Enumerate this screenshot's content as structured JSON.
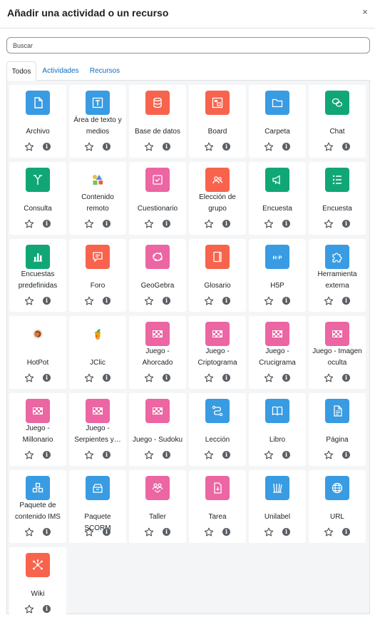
{
  "header": {
    "title": "Añadir una actividad o un recurso",
    "close_label": "×"
  },
  "search": {
    "placeholder": "Buscar"
  },
  "tabs": [
    {
      "label": "Todos",
      "active": true
    },
    {
      "label": "Actividades",
      "active": false
    },
    {
      "label": "Recursos",
      "active": false
    }
  ],
  "colors": {
    "blue": "#399be2",
    "orange": "#f7634d",
    "green": "#11a676",
    "pink": "#eb66a2",
    "tab_link": "#0f6cbf",
    "panel_bg": "#f4f5f7"
  },
  "items": [
    {
      "name": "Archivo",
      "icon": "file-icon",
      "color": "blue"
    },
    {
      "name": "Área de texto y medios",
      "icon": "text-media-icon",
      "color": "blue"
    },
    {
      "name": "Base de datos",
      "icon": "database-icon",
      "color": "orange"
    },
    {
      "name": "Board",
      "icon": "board-icon",
      "color": "orange"
    },
    {
      "name": "Carpeta",
      "icon": "folder-icon",
      "color": "blue"
    },
    {
      "name": "Chat",
      "icon": "chat-icon",
      "color": "green"
    },
    {
      "name": "Consulta",
      "icon": "choice-icon",
      "color": "green"
    },
    {
      "name": "Contenido remoto",
      "icon": "remote-content-icon",
      "color": "none"
    },
    {
      "name": "Cuestionario",
      "icon": "quiz-icon",
      "color": "pink"
    },
    {
      "name": "Elección de grupo",
      "icon": "group-choice-icon",
      "color": "orange"
    },
    {
      "name": "Encuesta",
      "icon": "feedback-icon",
      "color": "green"
    },
    {
      "name": "Encuesta",
      "icon": "survey-icon",
      "color": "green"
    },
    {
      "name": "Encuestas predefinidas",
      "icon": "bar-chart-icon",
      "color": "green"
    },
    {
      "name": "Foro",
      "icon": "forum-icon",
      "color": "orange"
    },
    {
      "name": "GeoGebra",
      "icon": "geogebra-icon",
      "color": "pink"
    },
    {
      "name": "Glosario",
      "icon": "glossary-icon",
      "color": "orange"
    },
    {
      "name": "H5P",
      "icon": "h5p-icon",
      "color": "blue"
    },
    {
      "name": "Herramienta externa",
      "icon": "puzzle-icon",
      "color": "blue"
    },
    {
      "name": "HotPot",
      "icon": "hotpot-icon",
      "color": "none"
    },
    {
      "name": "JClic",
      "icon": "jclic-icon",
      "color": "none"
    },
    {
      "name": "Juego - Ahorcado",
      "icon": "game-icon",
      "color": "pink"
    },
    {
      "name": "Juego - Criptograma",
      "icon": "game-icon",
      "color": "pink"
    },
    {
      "name": "Juego - Crucigrama",
      "icon": "game-icon",
      "color": "pink"
    },
    {
      "name": "Juego - Imagen oculta",
      "icon": "game-icon",
      "color": "pink"
    },
    {
      "name": "Juego - Millonario",
      "icon": "game-icon",
      "color": "pink"
    },
    {
      "name": "Juego - Serpientes y…",
      "icon": "game-icon",
      "color": "pink"
    },
    {
      "name": "Juego - Sudoku",
      "icon": "game-icon",
      "color": "pink"
    },
    {
      "name": "Lección",
      "icon": "lesson-icon",
      "color": "blue"
    },
    {
      "name": "Libro",
      "icon": "book-icon",
      "color": "blue"
    },
    {
      "name": "Página",
      "icon": "page-icon",
      "color": "blue"
    },
    {
      "name": "Paquete de contenido IMS",
      "icon": "ims-package-icon",
      "color": "blue"
    },
    {
      "name": "Paquete SCORM",
      "icon": "scorm-icon",
      "color": "blue"
    },
    {
      "name": "Taller",
      "icon": "workshop-icon",
      "color": "pink"
    },
    {
      "name": "Tarea",
      "icon": "assignment-icon",
      "color": "pink"
    },
    {
      "name": "Unilabel",
      "icon": "unilabel-icon",
      "color": "blue"
    },
    {
      "name": "URL",
      "icon": "globe-icon",
      "color": "blue"
    },
    {
      "name": "Wiki",
      "icon": "wiki-icon",
      "color": "orange"
    }
  ],
  "item_actions": {
    "star_icon": "star-icon",
    "info_icon": "info-icon",
    "info_label": "i"
  }
}
